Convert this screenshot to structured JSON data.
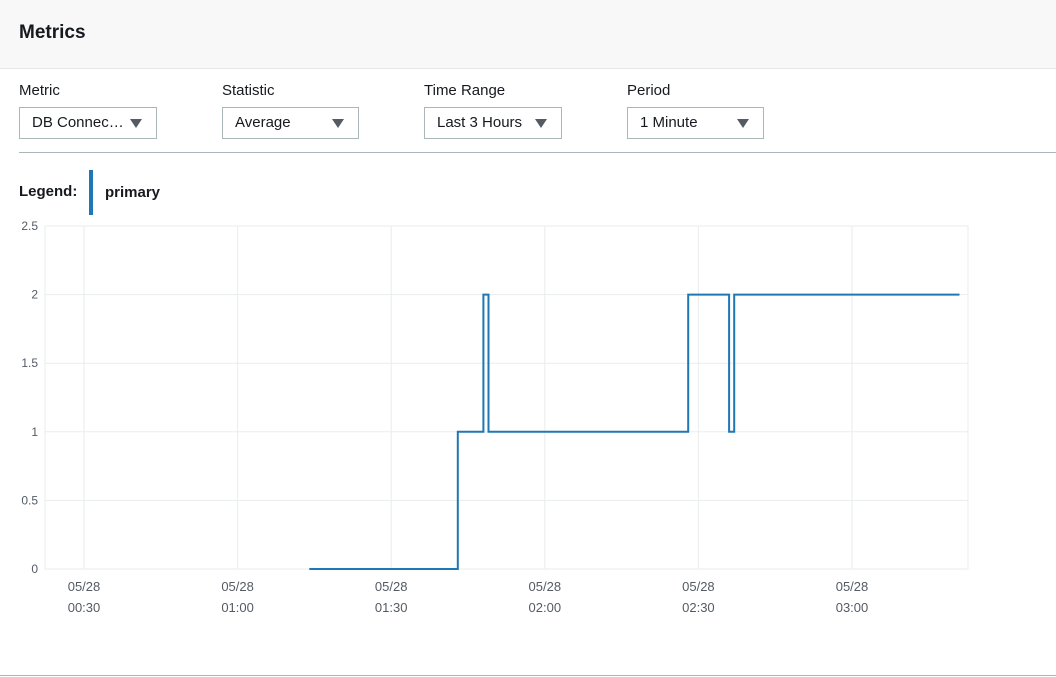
{
  "header": {
    "title": "Metrics"
  },
  "controls": [
    {
      "label": "Metric",
      "value": "DB Connec…"
    },
    {
      "label": "Statistic",
      "value": "Average"
    },
    {
      "label": "Time Range",
      "value": "Last 3 Hours"
    },
    {
      "label": "Period",
      "value": "1 Minute"
    }
  ],
  "legend": {
    "label": "Legend:",
    "series_name": "primary",
    "color": "#1f77b4"
  },
  "chart_data": {
    "type": "line",
    "step": true,
    "ylim": [
      0,
      2.5
    ],
    "yticks": [
      "0",
      "0.5",
      "1",
      "1.5",
      "2",
      "2.5"
    ],
    "xticks": [
      {
        "date": "05/28",
        "time": "00:30"
      },
      {
        "date": "05/28",
        "time": "01:00"
      },
      {
        "date": "05/28",
        "time": "01:30"
      },
      {
        "date": "05/28",
        "time": "02:00"
      },
      {
        "date": "05/28",
        "time": "02:30"
      },
      {
        "date": "05/28",
        "time": "03:00"
      }
    ],
    "grid": true,
    "series": [
      {
        "name": "primary",
        "color": "#1f77b4",
        "points": [
          [
            "01:14",
            0
          ],
          [
            "01:43",
            0
          ],
          [
            "01:43",
            1
          ],
          [
            "01:48",
            1
          ],
          [
            "01:48",
            2
          ],
          [
            "01:49",
            2
          ],
          [
            "01:49",
            1
          ],
          [
            "02:28",
            1
          ],
          [
            "02:28",
            2
          ],
          [
            "02:36",
            2
          ],
          [
            "02:36",
            1
          ],
          [
            "02:37",
            1
          ],
          [
            "02:37",
            2
          ],
          [
            "03:21",
            2
          ]
        ]
      }
    ]
  }
}
